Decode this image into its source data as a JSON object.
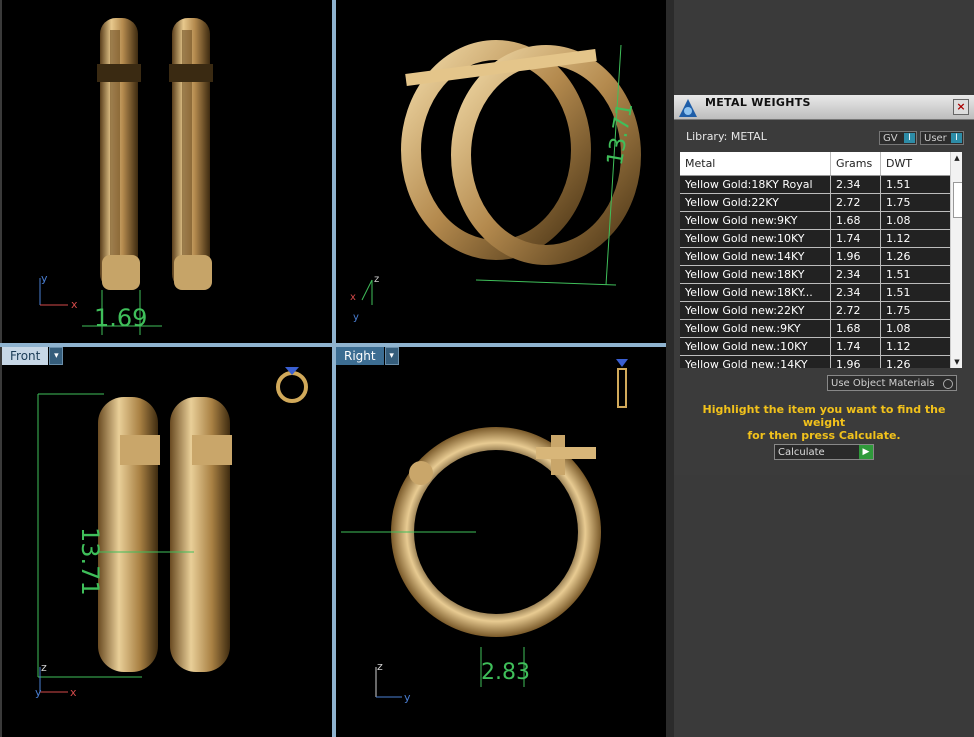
{
  "viewports": {
    "front_label": "Front",
    "right_label": "Right",
    "top_dimension": "1.69",
    "persp_dimension": "13.71",
    "front_dimension": "13.71",
    "right_dimension": "2.83",
    "axis_x": "x",
    "axis_y": "y",
    "axis_z": "z"
  },
  "panel": {
    "title": "METAL WEIGHTS",
    "library": "Library: METAL",
    "gv_label": "GV",
    "user_label": "User",
    "columns": [
      "Metal",
      "Grams",
      "DWT"
    ],
    "rows": [
      {
        "metal": "Yellow Gold:18KY Royal",
        "grams": "2.34",
        "dwt": "1.51"
      },
      {
        "metal": "Yellow Gold:22KY",
        "grams": "2.72",
        "dwt": "1.75"
      },
      {
        "metal": "Yellow Gold new:9KY",
        "grams": "1.68",
        "dwt": "1.08"
      },
      {
        "metal": "Yellow Gold new:10KY",
        "grams": "1.74",
        "dwt": "1.12"
      },
      {
        "metal": "Yellow Gold new:14KY",
        "grams": "1.96",
        "dwt": "1.26"
      },
      {
        "metal": "Yellow Gold new:18KY",
        "grams": "2.34",
        "dwt": "1.51"
      },
      {
        "metal": "Yellow Gold new:18KY...",
        "grams": "2.34",
        "dwt": "1.51"
      },
      {
        "metal": "Yellow Gold new:22KY",
        "grams": "2.72",
        "dwt": "1.75"
      },
      {
        "metal": "Yellow Gold new.:9KY",
        "grams": "1.68",
        "dwt": "1.08"
      },
      {
        "metal": "Yellow Gold new.:10KY",
        "grams": "1.74",
        "dwt": "1.12"
      },
      {
        "metal": "Yellow Gold new.:14KY",
        "grams": "1.96",
        "dwt": "1.26"
      }
    ],
    "use_object_materials": "Use Object Materials",
    "hint_line1": "Highlight the item you want to find the weight",
    "hint_line2": "for then press Calculate.",
    "calculate_label": "Calculate"
  }
}
